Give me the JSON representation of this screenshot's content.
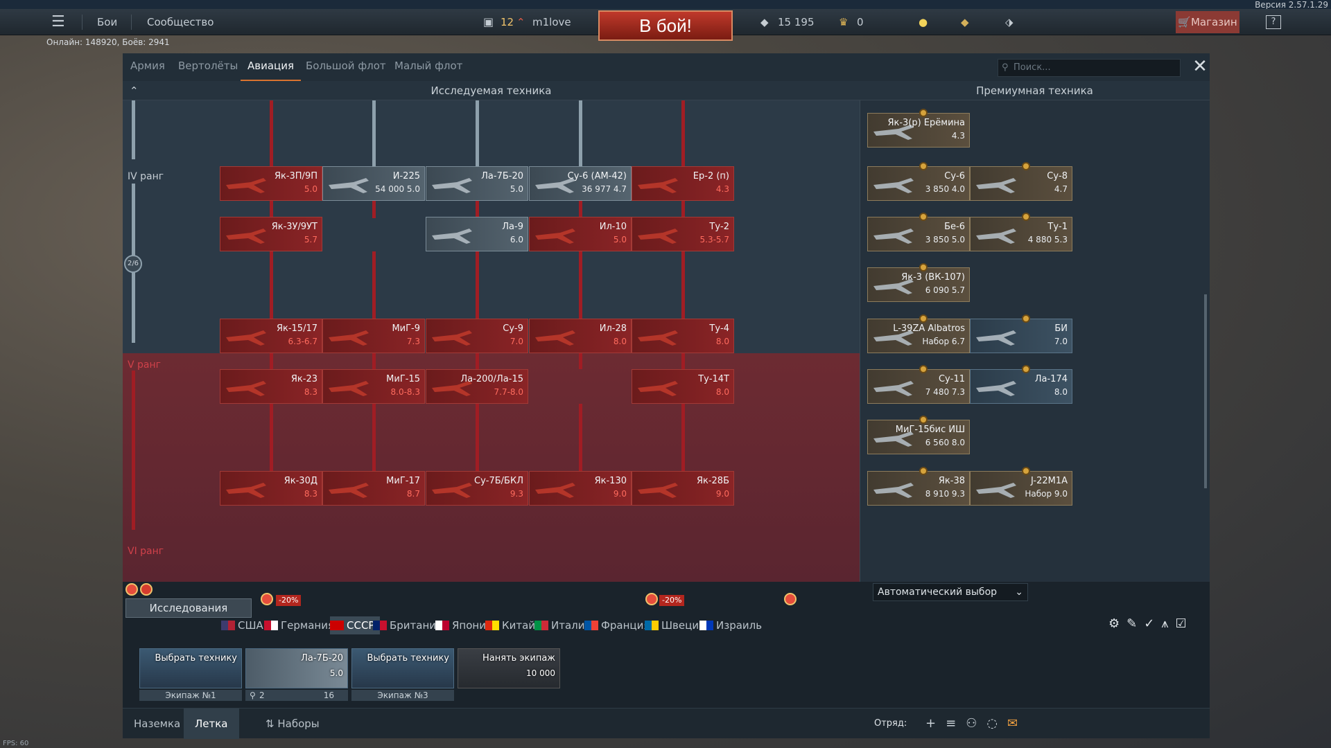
{
  "version": "Версия 2.57.1.29",
  "topbar": {
    "menu_icon": "hamburger-icon",
    "battles": "Бои",
    "community": "Сообщество",
    "level": "12",
    "username": "m1love",
    "battle_button": "В бой!",
    "silver": "15 195",
    "gold": "0",
    "shop": "Магазин",
    "help": "?"
  },
  "online": "Онлайн: 148920, Боёв: 2941",
  "tabs": [
    "Армия",
    "Вертолёты",
    "Авиация",
    "Большой флот",
    "Малый флот"
  ],
  "search_placeholder": "Поиск...",
  "headers": {
    "researched": "Исследуемая техника",
    "premium": "Премиумная техника"
  },
  "ranks": {
    "iv": "IV ранг",
    "v": "V ранг",
    "vi": "VI ранг",
    "progress": "2/6"
  },
  "tree_cards": [
    {
      "name": "Як-3П/9П",
      "br": "5.0",
      "style": "red"
    },
    {
      "name": "И-225",
      "br": "54 000  5.0",
      "style": "gray"
    },
    {
      "name": "Ла-7Б-20",
      "br": "5.0",
      "style": "gray"
    },
    {
      "name": "Су-6 (АМ-42)",
      "br": "36 977  4.7",
      "style": "gray"
    },
    {
      "name": "Ер-2 (п)",
      "br": "4.3",
      "style": "red"
    },
    {
      "name": "Як-3У/9УТ",
      "br": "5.7",
      "style": "red"
    },
    {
      "name": "Ла-9",
      "br": "6.0",
      "style": "gray"
    },
    {
      "name": "Ил-10",
      "br": "5.0",
      "style": "red"
    },
    {
      "name": "Ту-2",
      "br": "5.3-5.7",
      "style": "red"
    },
    {
      "name": "Як-15/17",
      "br": "6.3-6.7",
      "style": "red"
    },
    {
      "name": "МиГ-9",
      "br": "7.3",
      "style": "red"
    },
    {
      "name": "Су-9",
      "br": "7.0",
      "style": "red"
    },
    {
      "name": "Ил-28",
      "br": "8.0",
      "style": "red"
    },
    {
      "name": "Ту-4",
      "br": "8.0",
      "style": "red"
    },
    {
      "name": "Як-23",
      "br": "8.3",
      "style": "red"
    },
    {
      "name": "МиГ-15",
      "br": "8.0-8.3",
      "style": "red"
    },
    {
      "name": "Ла-200/Ла-15",
      "br": "7.7-8.0",
      "style": "red"
    },
    {
      "name": "Ту-14Т",
      "br": "8.0",
      "style": "red"
    },
    {
      "name": "Як-30Д",
      "br": "8.3",
      "style": "red"
    },
    {
      "name": "МиГ-17",
      "br": "8.7",
      "style": "red"
    },
    {
      "name": "Су-7Б/БКЛ",
      "br": "9.3",
      "style": "red"
    },
    {
      "name": "Як-130",
      "br": "9.0",
      "style": "red"
    },
    {
      "name": "Як-28Б",
      "br": "9.0",
      "style": "red"
    }
  ],
  "premium_cards": [
    {
      "name": "Як-3(р) Ерёмина",
      "br": "4.3",
      "style": "prem"
    },
    {
      "name": "Су-6",
      "br": "3 850  4.0",
      "style": "prem"
    },
    {
      "name": "Су-8",
      "br": "4.7",
      "style": "prem"
    },
    {
      "name": "Бе-6",
      "br": "3 850  5.0",
      "style": "prem"
    },
    {
      "name": "Ту-1",
      "br": "4 880  5.3",
      "style": "prem"
    },
    {
      "name": "Як-3 (ВК-107)",
      "br": "6 090  5.7",
      "style": "prem"
    },
    {
      "name": "L-39ZA Albatros",
      "br": "Набор 6.7",
      "style": "prem"
    },
    {
      "name": "БИ",
      "br": "7.0",
      "style": "blue"
    },
    {
      "name": "Су-11",
      "br": "7 480  7.3",
      "style": "prem"
    },
    {
      "name": "Ла-174",
      "br": "8.0",
      "style": "blue"
    },
    {
      "name": "МиГ-15бис ИШ",
      "br": "6 560  8.0",
      "style": "prem"
    },
    {
      "name": "Як-38",
      "br": "8 910  9.3",
      "style": "prem"
    },
    {
      "name": "J-22M1A",
      "br": "Набор 9.0",
      "style": "prem"
    }
  ],
  "controls": {
    "research_button": "Исследования",
    "auto_select": "Автоматический выбор",
    "discount": "-20%"
  },
  "nations": [
    {
      "name": "США",
      "colors": [
        "#3c3b6e",
        "#b22234"
      ]
    },
    {
      "name": "Германия",
      "colors": [
        "#c8102e",
        "#ffffff"
      ]
    },
    {
      "name": "СССР",
      "colors": [
        "#cc0000",
        "#cc0000"
      ]
    },
    {
      "name": "Британия",
      "colors": [
        "#012169",
        "#c8102e"
      ]
    },
    {
      "name": "Япония",
      "colors": [
        "#ffffff",
        "#bc002d"
      ]
    },
    {
      "name": "Китай",
      "colors": [
        "#de2910",
        "#ffde00"
      ]
    },
    {
      "name": "Италия",
      "colors": [
        "#009246",
        "#ce2b37"
      ]
    },
    {
      "name": "Франция",
      "colors": [
        "#0055a4",
        "#ef4135"
      ]
    },
    {
      "name": "Швеция",
      "colors": [
        "#006aa7",
        "#fecc00"
      ]
    },
    {
      "name": "Израиль",
      "colors": [
        "#ffffff",
        "#0038b8"
      ]
    }
  ],
  "crews": [
    {
      "title": "Выбрать технику",
      "label": "Экипаж №1"
    },
    {
      "title": "Ла-7Б-20",
      "br": "5.0",
      "label_left": "2",
      "label_right": "16"
    },
    {
      "title": "Выбрать технику",
      "label": "Экипаж №3"
    },
    {
      "title": "Нанять экипаж",
      "cost": "10 000"
    }
  ],
  "footer": {
    "ground": "Наземка",
    "air": "Летка",
    "presets": "Наборы",
    "squad": "Отряд:"
  },
  "fps": "FPS: 60"
}
